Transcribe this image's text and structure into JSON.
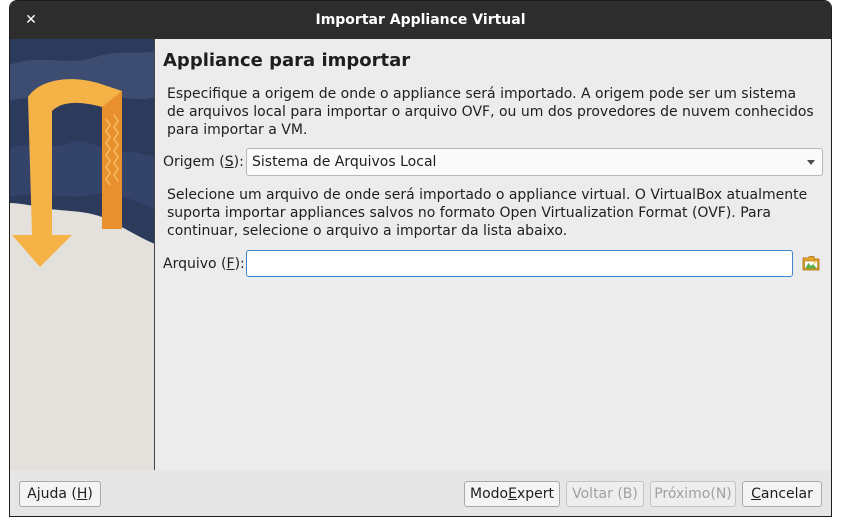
{
  "window": {
    "title": "Importar Appliance Virtual",
    "close_glyph": "✕"
  },
  "content": {
    "heading": "Appliance para importar",
    "intro": "Especifique a origem de onde o appliance será importado. A origem pode ser um sistema de arquivos local para importar o arquivo OVF, ou um dos provedores de nuvem conhecidos para importar a VM.",
    "origin": {
      "label_pre": "Origem (",
      "label_key": "S",
      "label_post": "):",
      "value": "Sistema de Arquivos Local"
    },
    "instructions": "Selecione um arquivo de onde será importado o appliance virtual. O VirtualBox atualmente suporta importar appliances salvos no formato Open Virtualization Format (OVF). Para continuar, selecione o arquivo a importar da lista abaixo.",
    "file": {
      "label_pre": "Arquivo (",
      "label_key": "F",
      "label_post": "):",
      "value": "",
      "icon": "folder-open-icon"
    }
  },
  "buttons": {
    "help": {
      "pre": "Ajuda (",
      "key": "H",
      "post": ")"
    },
    "expert": {
      "pre": "Modo ",
      "key": "E",
      "post": "xpert"
    },
    "back": {
      "label": "Voltar (B)",
      "enabled": false
    },
    "next": {
      "label": "Próximo(N)",
      "enabled": false
    },
    "cancel": {
      "pre": "",
      "key": "C",
      "post": "ancelar"
    }
  },
  "colors": {
    "titlebar": "#2d2d2d",
    "arrow": "#f5b347",
    "arrow_dark": "#e8902e",
    "sky": "#2c3a5c",
    "focus": "#3c85c9"
  }
}
